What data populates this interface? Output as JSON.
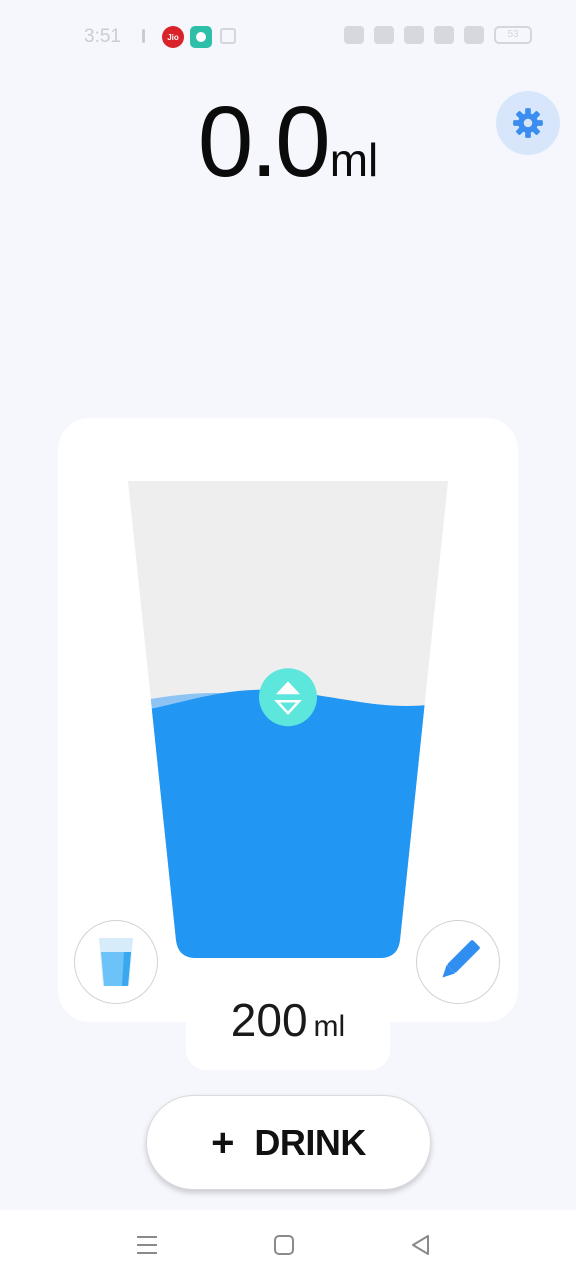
{
  "status_bar": {
    "time": "3:51",
    "jio_label": "Jio",
    "battery": "53"
  },
  "header": {
    "amount_value": "0.0",
    "amount_unit": "ml"
  },
  "glass": {
    "fill_fraction": 0.53,
    "colors": {
      "water": "#2196f3",
      "empty": "#eeeeee",
      "handle": "#5de6dc"
    }
  },
  "volume": {
    "value": "200",
    "unit": "ml"
  },
  "drink_button": {
    "icon": "+",
    "label": "DRINK"
  },
  "icons": {
    "settings": "gear-icon",
    "cup": "cup-icon",
    "edit": "pencil-icon",
    "level": "adjust-level-icon"
  },
  "nav": {
    "items": [
      "menu",
      "home",
      "back"
    ]
  }
}
